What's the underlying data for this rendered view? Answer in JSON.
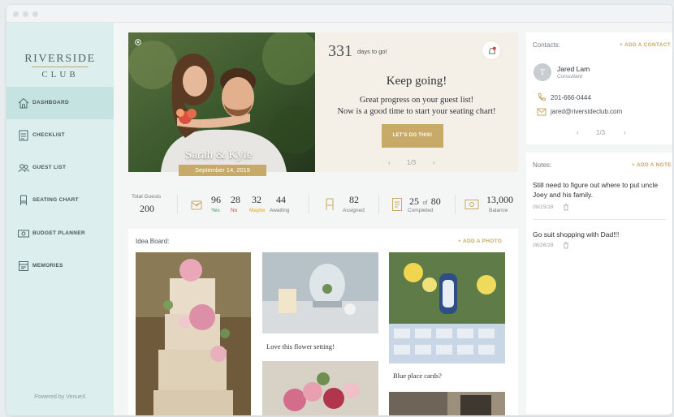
{
  "brand": {
    "line1": "RIVERSIDE",
    "line2": "CLUB"
  },
  "nav": [
    {
      "label": "DASHBOARD",
      "icon": "home-icon",
      "active": true
    },
    {
      "label": "CHECKLIST",
      "icon": "checklist-icon"
    },
    {
      "label": "GUEST LIST",
      "icon": "guests-icon"
    },
    {
      "label": "SEATING CHART",
      "icon": "chair-icon"
    },
    {
      "label": "BUDGET PLANNER",
      "icon": "money-icon"
    },
    {
      "label": "MEMORIES",
      "icon": "album-icon"
    }
  ],
  "powered_by": "Powered by VenueX",
  "hero": {
    "couple": "Sarah & Kyle",
    "date": "September 14, 2019",
    "days_number": "331",
    "days_label": "days to go!",
    "headline": "Keep going!",
    "message_line1": "Great progress on your guest list!",
    "message_line2": "Now is a good time to start your seating chart!",
    "cta": "LET'S DO THIS!",
    "pager": "1/3"
  },
  "stats": {
    "total_label": "Total Guests",
    "total_value": "200",
    "yes_value": "96",
    "yes_label": "Yes",
    "no_value": "28",
    "no_label": "No",
    "maybe_value": "32",
    "maybe_label": "Maybe",
    "awaiting_value": "44",
    "awaiting_label": "Awaiting",
    "assigned_value": "82",
    "assigned_label": "Assigned",
    "completed_done": "25",
    "completed_of": "of",
    "completed_total": "80",
    "completed_label": "Completed",
    "balance_value": "13,000",
    "balance_label": "Balance"
  },
  "board": {
    "title": "Idea Board:",
    "add": "+ ADD A PHOTO",
    "captions": [
      "Love this flower setting!",
      "Blue place cards?"
    ]
  },
  "contacts": {
    "title": "Contacts:",
    "add": "+ ADD A CONTACT",
    "avatar_initial": "T",
    "name": "Jared Lam",
    "role": "Consultant",
    "phone": "201-666-0444",
    "email": "jared@riversideclub.com",
    "pager": "1/3"
  },
  "notes": {
    "title": "Notes:",
    "add": "+ ADD A NOTE",
    "items": [
      {
        "text": "Still need to figure out where to put uncle Joey and his family.",
        "date": "09/15/18"
      },
      {
        "text": "Go suit shopping with Dad!!!",
        "date": "08/26/18"
      }
    ]
  },
  "colors": {
    "accent": "#c7a968",
    "sidebar": "#dcefee",
    "sidebar_active": "#c4e3e1",
    "yes": "#3a9a5b",
    "no": "#d0463f",
    "maybe": "#e3a623"
  }
}
